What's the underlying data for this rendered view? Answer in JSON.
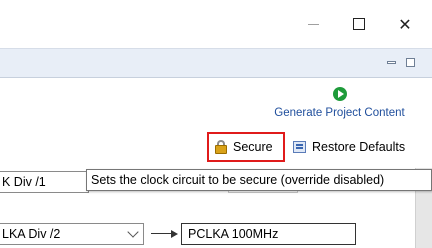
{
  "window": {
    "controls": {
      "minimize_icon": "minimize-icon",
      "maximize_icon": "maximize-icon",
      "close_icon": "close-icon",
      "close_glyph": "✕"
    }
  },
  "view": {
    "minimize_icon": "view-minimize-icon",
    "maximize_icon": "view-maximize-icon"
  },
  "actions": {
    "generate": {
      "icon": "run-icon",
      "label": "Generate Project Content",
      "color": "#1f4e9c"
    },
    "secure": {
      "icon": "lock-icon",
      "label": "Secure",
      "highlight_color": "#e01b1b"
    },
    "restore": {
      "icon": "restore-defaults-icon",
      "label": "Restore Defaults"
    }
  },
  "tooltip": {
    "text": "Sets the clock circuit to be secure (override disabled)"
  },
  "clock": {
    "div1": "K Div /1",
    "div2": {
      "value": "LKA Div /2"
    },
    "pclka": "PCLKA 100MHz"
  }
}
